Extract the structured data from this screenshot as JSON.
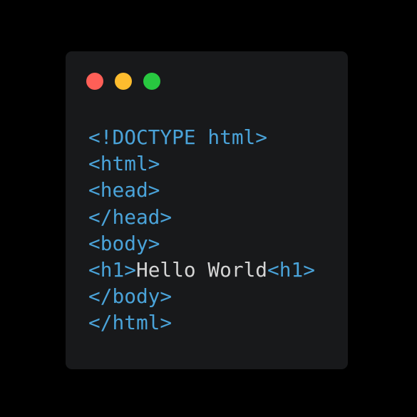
{
  "window": {
    "background": "#18191b",
    "controls": [
      {
        "name": "close",
        "color": "#ff5f57"
      },
      {
        "name": "minimize",
        "color": "#febc2e"
      },
      {
        "name": "maximize",
        "color": "#28c840"
      }
    ]
  },
  "code": {
    "tag_color": "#4aa3d9",
    "text_color": "#d4d4d4",
    "lines": [
      {
        "tokens": [
          {
            "text": "<!DOCTYPE html>",
            "kind": "tag"
          }
        ]
      },
      {
        "tokens": [
          {
            "text": "<html>",
            "kind": "tag"
          }
        ]
      },
      {
        "tokens": [
          {
            "text": "<head>",
            "kind": "tag"
          }
        ]
      },
      {
        "tokens": [
          {
            "text": "</head>",
            "kind": "tag"
          }
        ]
      },
      {
        "tokens": [
          {
            "text": "<body>",
            "kind": "tag"
          }
        ]
      },
      {
        "tokens": [
          {
            "text": "<h1>",
            "kind": "tag"
          },
          {
            "text": "Hello World",
            "kind": "text"
          },
          {
            "text": "<h1>",
            "kind": "tag"
          }
        ]
      },
      {
        "tokens": [
          {
            "text": "</body>",
            "kind": "tag"
          }
        ]
      },
      {
        "tokens": [
          {
            "text": "</html>",
            "kind": "tag"
          }
        ]
      }
    ]
  }
}
